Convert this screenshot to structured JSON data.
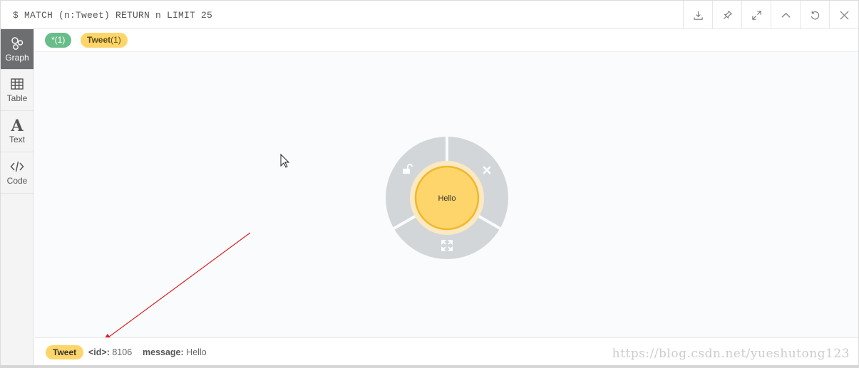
{
  "query": "$ MATCH (n:Tweet) RETURN n LIMIT 25",
  "toolbar": [
    {
      "name": "download-button",
      "icon": "download-icon"
    },
    {
      "name": "pin-button",
      "icon": "pin-icon"
    },
    {
      "name": "fullscreen-button",
      "icon": "expand-icon"
    },
    {
      "name": "collapse-button",
      "icon": "chevron-up-icon"
    },
    {
      "name": "rerun-button",
      "icon": "refresh-icon"
    },
    {
      "name": "close-button",
      "icon": "close-icon"
    }
  ],
  "sidebar": {
    "items": [
      {
        "label": "Graph",
        "icon": "graph-icon",
        "active": true
      },
      {
        "label": "Table",
        "icon": "table-icon",
        "active": false
      },
      {
        "label": "Text",
        "icon": "text-icon",
        "active": false
      },
      {
        "label": "Code",
        "icon": "code-icon",
        "active": false
      }
    ]
  },
  "labels": {
    "all": "*(1)",
    "tweet_name": "Tweet",
    "tweet_count": "(1)"
  },
  "graph": {
    "node_caption": "Hello",
    "ring_actions": [
      "unlock-icon",
      "dismiss-icon",
      "expand-node-icon"
    ]
  },
  "inspector": {
    "label": "Tweet",
    "id_key": "<id>:",
    "id_value": "8106",
    "message_key": "message:",
    "message_value": "Hello"
  },
  "watermark": "https://blog.csdn.net/yueshutong123",
  "colors": {
    "node_fill": "#fdd56a",
    "node_stroke": "#f0b72f",
    "ring": "#d3d6d9",
    "label_all": "#68bd8b",
    "active_tab": "#6d6e70",
    "arrow": "#e02020"
  }
}
